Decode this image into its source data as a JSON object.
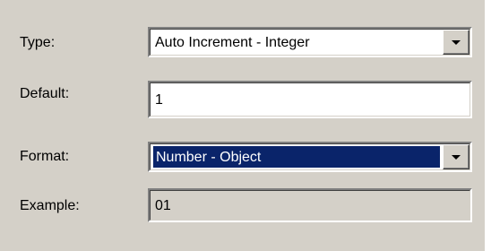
{
  "form": {
    "type": {
      "label": "Type:",
      "value": "Auto Increment - Integer"
    },
    "default": {
      "label": "Default:",
      "value": "1"
    },
    "format": {
      "label": "Format:",
      "value": "Number - Object"
    },
    "example": {
      "label": "Example:",
      "value": "01"
    }
  },
  "icons": {
    "dropdown": "chevron-down-icon"
  }
}
